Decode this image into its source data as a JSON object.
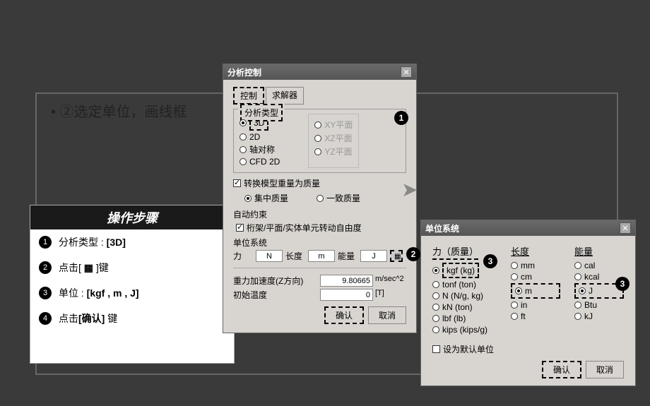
{
  "main_bullet": "• ②选定单位，画线框",
  "steps": {
    "header": "操作步骤",
    "items": [
      {
        "n": "1",
        "html": "分析类型 : <b>[3D]</b>"
      },
      {
        "n": "2",
        "html": "点击[ <b>▦</b> ]键"
      },
      {
        "n": "3",
        "html": "单位 : <b>[kgf , m , J]</b>"
      },
      {
        "n": "4",
        "html": "点击<b>[确认]</b> 键"
      }
    ]
  },
  "analysis": {
    "title": "分析控制",
    "tabs": [
      "控制",
      "求解器"
    ],
    "group_type": "分析类型",
    "type_opts": [
      "3D",
      "2D",
      "轴对称",
      "CFD 2D"
    ],
    "plane_opts": [
      "XY平面",
      "XZ平面",
      "YZ平面"
    ],
    "mass_convert": "转换模型重量为质量",
    "mass_opts": [
      "集中质量",
      "一致质量"
    ],
    "auto_constraint": "自动约束",
    "truss_check": "桁架/平面/实体单元转动自由度",
    "unit_sys": "单位系统",
    "units": {
      "force_l": "力",
      "force_v": "N",
      "len_l": "长度",
      "len_v": "m",
      "energy_l": "能量",
      "energy_v": "J"
    },
    "gravity_l": "重力加速度(Z方向)",
    "gravity_v": "9.80665",
    "gravity_u": "m/sec^2",
    "temp_l": "初始温度",
    "temp_v": "0",
    "temp_u": "[T]",
    "ok": "确认",
    "cancel": "取消"
  },
  "unitsdlg": {
    "title": "单位系统",
    "force_hdr": "力（质量）",
    "force_opts": [
      "kgf (kg)",
      "tonf (ton)",
      "N (N/g, kg)",
      "kN (ton)",
      "lbf (lb)",
      "kips (kips/g)"
    ],
    "len_hdr": "长度",
    "len_opts": [
      "mm",
      "cm",
      "m",
      "in",
      "ft"
    ],
    "energy_hdr": "能量",
    "energy_opts": [
      "cal",
      "kcal",
      "J",
      "Btu",
      "kJ"
    ],
    "default_chk": "设为默认单位",
    "ok": "确认",
    "cancel": "取消"
  }
}
